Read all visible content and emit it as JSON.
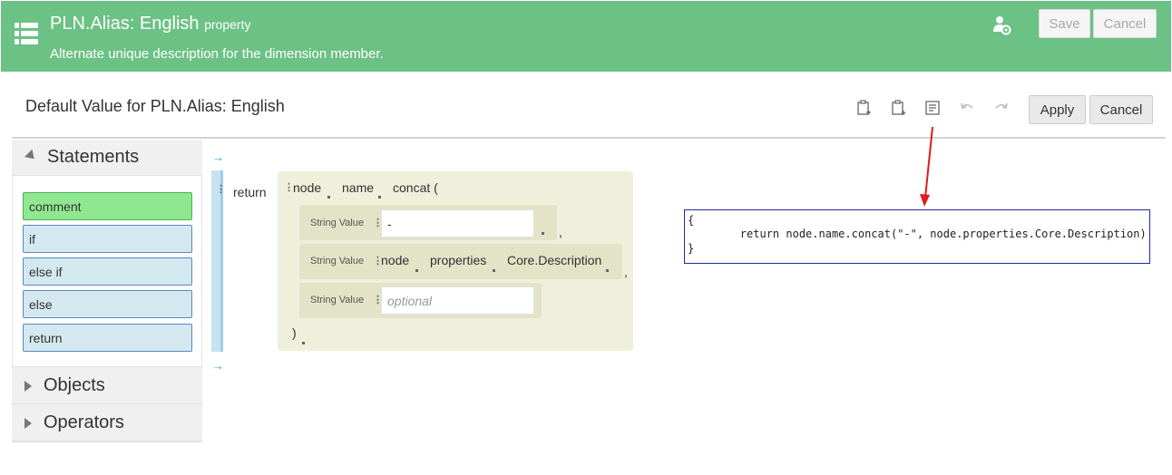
{
  "header": {
    "title": "PLN.Alias: English",
    "title_suffix": "property",
    "subtitle": "Alternate unique description for the dimension member.",
    "save_label": "Save",
    "cancel_label": "Cancel",
    "menu_icon": "list-menu-icon",
    "user_icon": "user-settings-icon"
  },
  "editor": {
    "title": "Default Value for PLN.Alias: English",
    "apply_label": "Apply",
    "cancel_label": "Cancel",
    "tools": [
      "copy-icon",
      "paste-icon",
      "view-script-icon",
      "undo-icon",
      "redo-icon"
    ]
  },
  "palette": {
    "statements_header": "Statements",
    "statements": [
      "comment",
      "if",
      "else if",
      "else",
      "return"
    ],
    "objects_header": "Objects",
    "operators_header": "Operators"
  },
  "expression": {
    "return_label": "return",
    "chain": [
      "node",
      "name",
      "concat ("
    ],
    "closing": ")",
    "params": [
      {
        "label": "String Value",
        "value": "-",
        "trailing": ","
      },
      {
        "label": "String Value",
        "chain": [
          "node",
          "properties",
          "Core.Description"
        ],
        "trailing": ","
      },
      {
        "label": "String Value",
        "placeholder": "optional"
      }
    ]
  },
  "code": {
    "line1": "{",
    "line2": "        return node.name.concat(\"-\", node.properties.Core.Description)",
    "line3": "}"
  },
  "colors": {
    "header_bg": "#6cc184",
    "highlight_green": "#8fe891",
    "statement_bg": "#d4e8f0",
    "annotation_arrow": "#e01b1b"
  }
}
